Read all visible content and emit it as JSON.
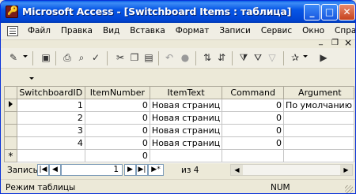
{
  "window": {
    "title": "Microsoft Access - [Switchboard Items : таблица]",
    "controls": {
      "minimize": "_",
      "maximize": "□",
      "close": "✕"
    }
  },
  "menu": {
    "items": [
      "Файл",
      "Правка",
      "Вид",
      "Вставка",
      "Формат",
      "Записи",
      "Сервис",
      "Окно",
      "Справка"
    ],
    "mdi": {
      "minimize": "_",
      "restore": "❐",
      "close": "×"
    }
  },
  "toolbar": {
    "icons": [
      "design-view-icon",
      "save-icon",
      "print-icon",
      "print-preview-icon",
      "spelling-icon",
      "cut-icon",
      "copy-icon",
      "paste-icon",
      "undo-icon",
      "hyperlink-icon",
      "sort-ascending-icon",
      "sort-descending-icon",
      "filter-by-selection-icon",
      "filter-by-form-icon",
      "apply-filter-icon",
      "new-record-icon"
    ]
  },
  "table": {
    "columns": [
      "SwitchboardID",
      "ItemNumber",
      "ItemText",
      "Command",
      "Argument"
    ],
    "rows": [
      {
        "switchboard_id": "1",
        "item_number": "0",
        "item_text": "Новая страниц",
        "command": "0",
        "argument": "По умолчанию"
      },
      {
        "switchboard_id": "2",
        "item_number": "0",
        "item_text": "Новая страниц",
        "command": "0",
        "argument": ""
      },
      {
        "switchboard_id": "3",
        "item_number": "0",
        "item_text": "Новая страниц",
        "command": "0",
        "argument": ""
      },
      {
        "switchboard_id": "4",
        "item_number": "0",
        "item_text": "Новая страниц",
        "command": "0",
        "argument": ""
      }
    ],
    "new_row": {
      "switchboard_id": "",
      "item_number": "0",
      "item_text": "",
      "command": "",
      "argument": ""
    },
    "new_row_marker": "*"
  },
  "navigation": {
    "label": "Запись:",
    "current_record": "1",
    "of_text": "из 4",
    "buttons": {
      "first": "|◀",
      "prev": "◀",
      "next": "▶",
      "last": "▶|",
      "new": "▶*"
    }
  },
  "status": {
    "mode": "Режим таблицы",
    "num": "NUM"
  }
}
